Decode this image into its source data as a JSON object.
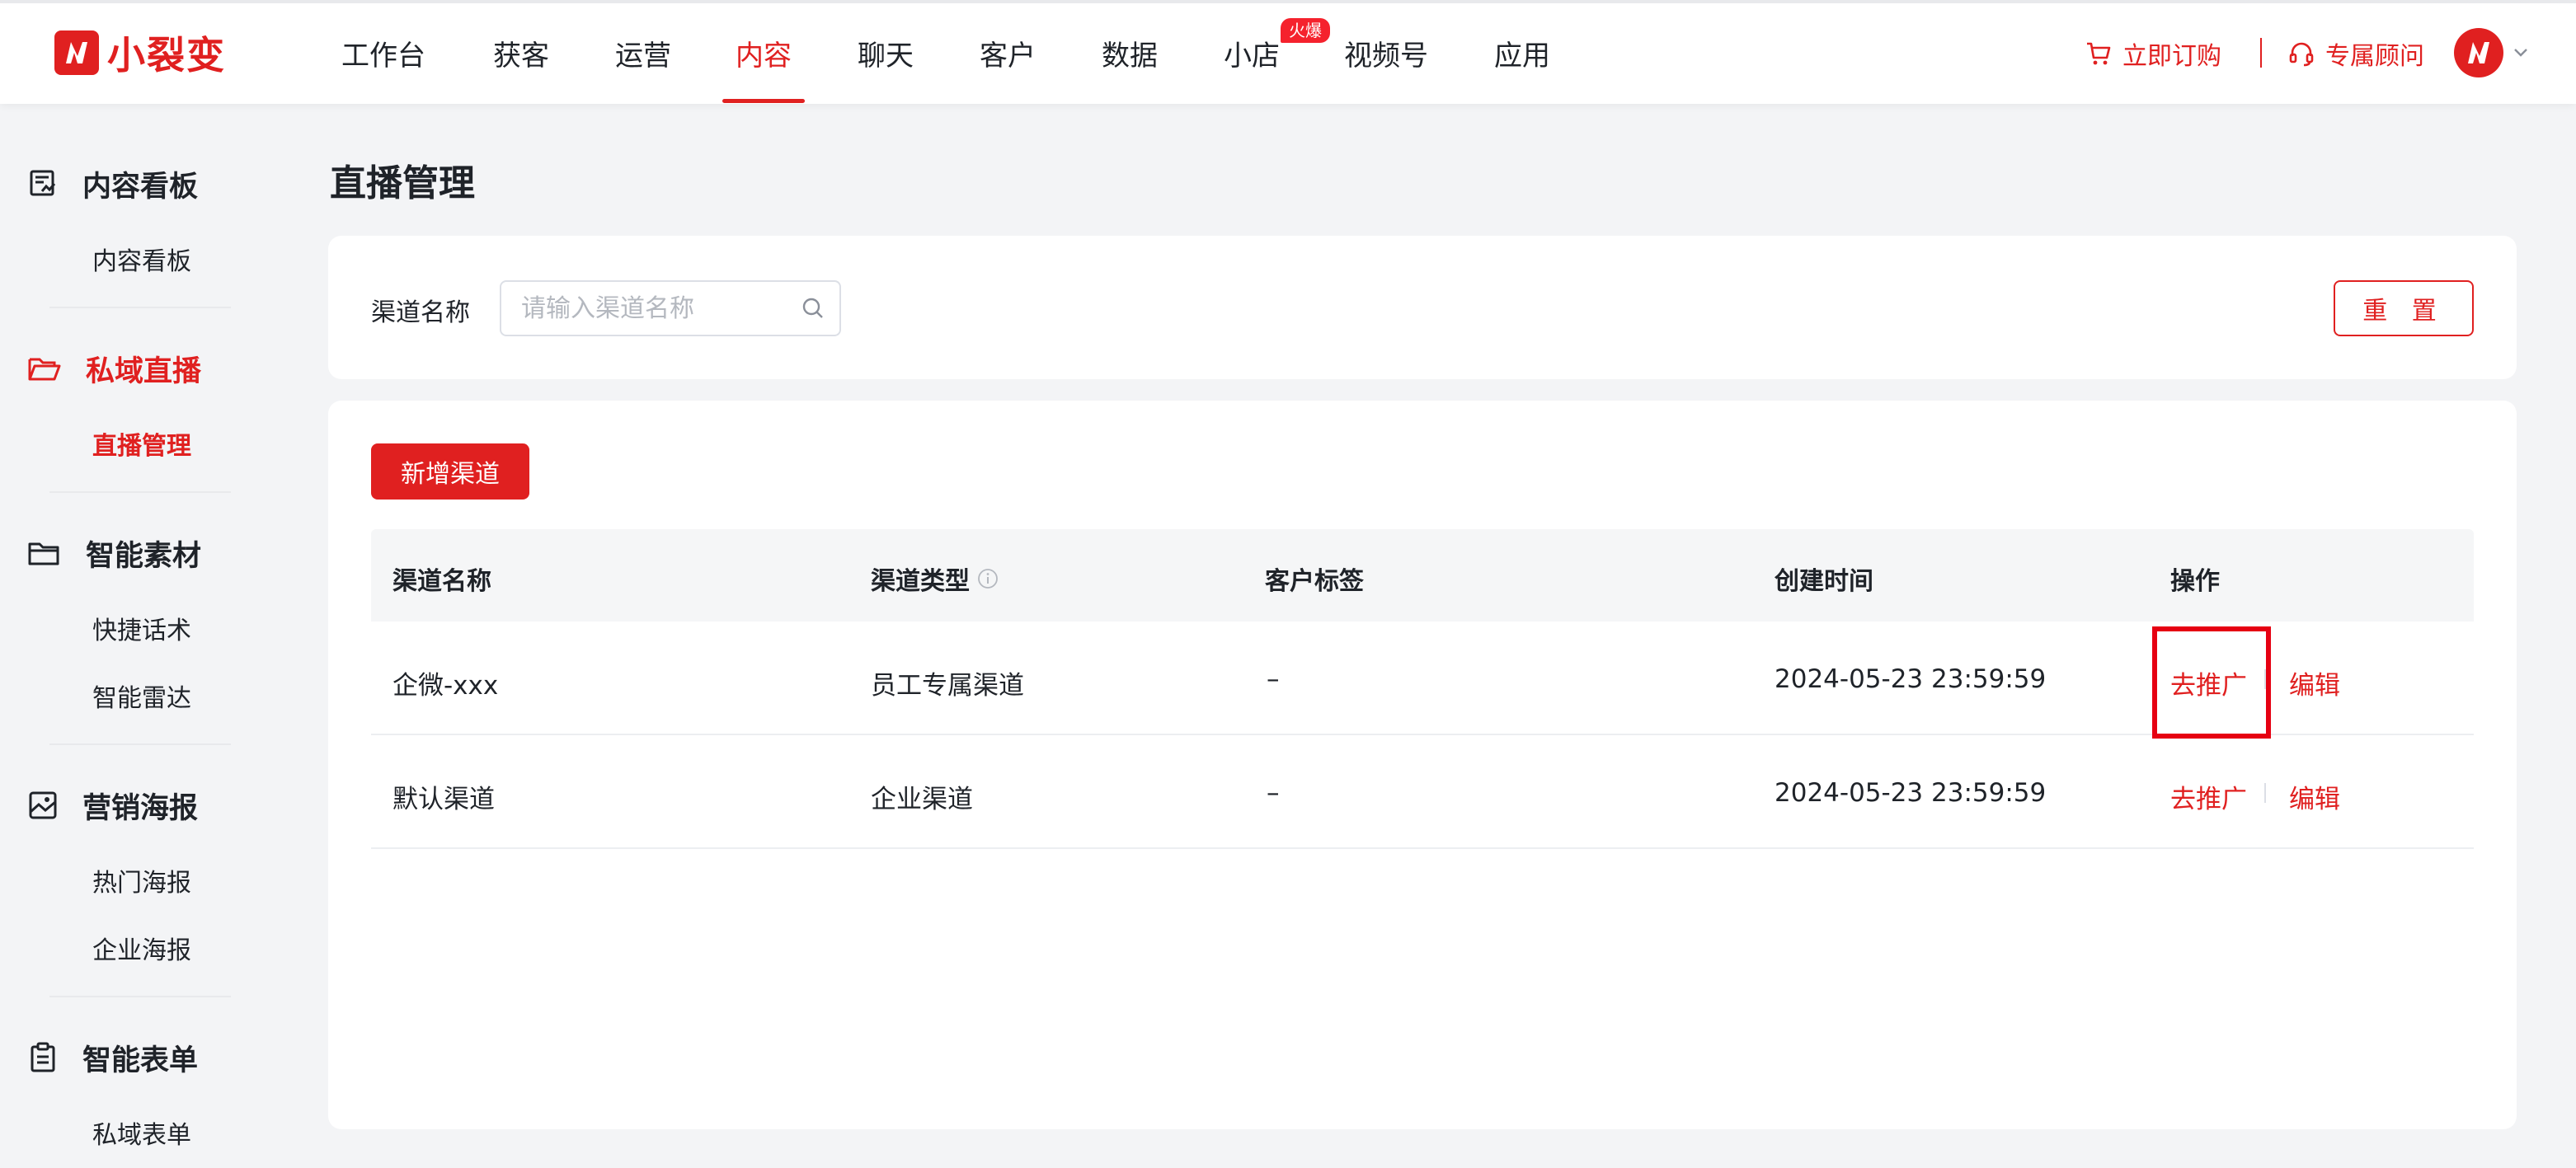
{
  "brand": {
    "name": "小裂变",
    "accent": "#e02020"
  },
  "nav": {
    "items": [
      "工作台",
      "获客",
      "运营",
      "内容",
      "聊天",
      "客户",
      "数据",
      "小店",
      "视频号",
      "应用"
    ],
    "active": "内容",
    "hot_badge": "火爆"
  },
  "header_right": {
    "order_label": "立即订购",
    "advisor_label": "专属顾问"
  },
  "sidebar": {
    "groups": [
      {
        "title": "内容看板",
        "icon": "dashboard-icon",
        "items": [
          "内容看板"
        ]
      },
      {
        "title": "私域直播",
        "icon": "folder-open-icon",
        "items": [
          "直播管理"
        ],
        "active": true
      },
      {
        "title": "智能素材",
        "icon": "folder-icon",
        "items": [
          "快捷话术",
          "智能雷达"
        ]
      },
      {
        "title": "营销海报",
        "icon": "poster-icon",
        "items": [
          "热门海报",
          "企业海报"
        ]
      },
      {
        "title": "智能表单",
        "icon": "clipboard-icon",
        "items": [
          "私域表单"
        ]
      }
    ],
    "active_item": "直播管理"
  },
  "page": {
    "title": "直播管理",
    "filter": {
      "label": "渠道名称",
      "placeholder": "请输入渠道名称",
      "value": ""
    },
    "reset_label": "重 置",
    "add_label": "新增渠道"
  },
  "table": {
    "columns": [
      "渠道名称",
      "渠道类型",
      "客户标签",
      "创建时间",
      "操作"
    ],
    "rows": [
      {
        "name": "企微-xxx",
        "type": "员工专属渠道",
        "tags": "–",
        "created": "2024-05-23 23:59:59",
        "op_promote": "去推广",
        "op_edit": "编辑"
      },
      {
        "name": "默认渠道",
        "type": "企业渠道",
        "tags": "–",
        "created": "2024-05-23 23:59:59",
        "op_promote": "去推广",
        "op_edit": "编辑"
      }
    ]
  }
}
